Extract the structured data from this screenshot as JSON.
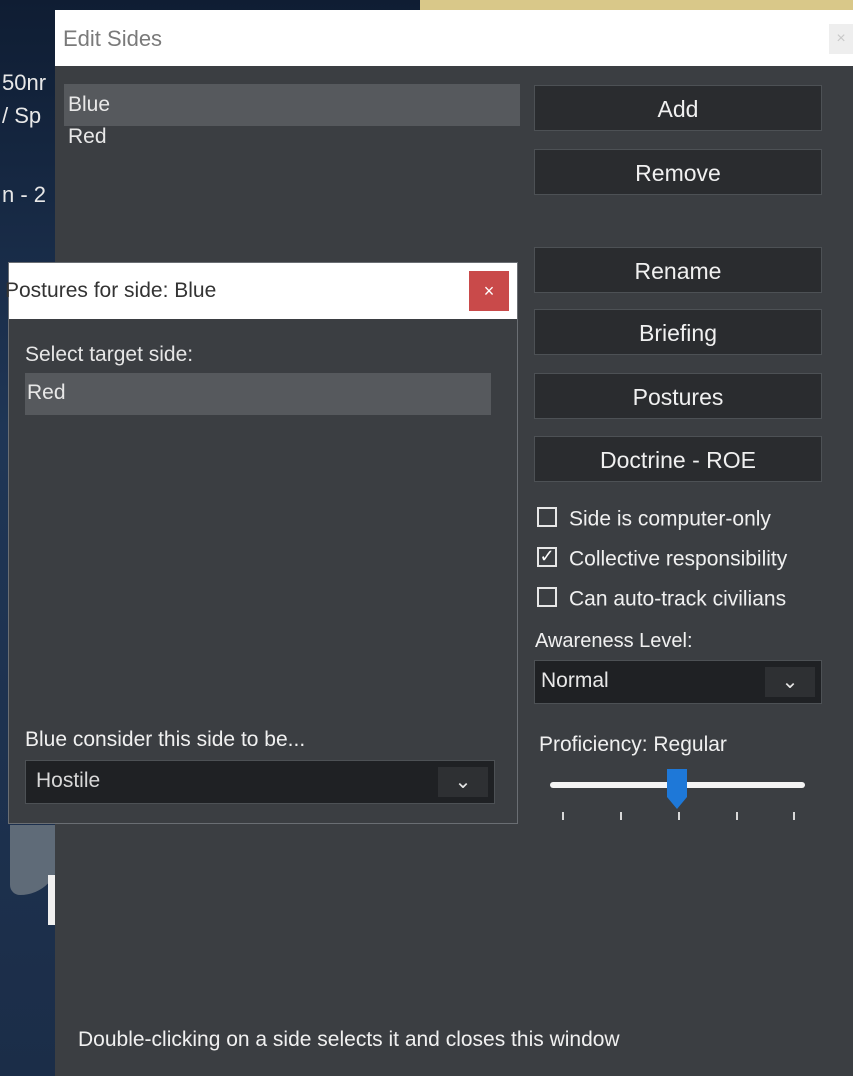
{
  "background": {
    "fragments": [
      "50nr",
      "/ Sp",
      "n - 2"
    ]
  },
  "edit_sides": {
    "title": "Edit Sides",
    "close_label": "×",
    "sides": [
      "Blue",
      "Red"
    ],
    "buttons": {
      "add": "Add",
      "remove": "Remove",
      "rename": "Rename",
      "briefing": "Briefing",
      "postures": "Postures",
      "doctrine": "Doctrine - ROE"
    },
    "checkboxes": [
      {
        "label": "Side is computer-only",
        "checked": false
      },
      {
        "label": "Collective responsibility",
        "checked": true
      },
      {
        "label": "Can auto-track civilians",
        "checked": false
      }
    ],
    "awareness": {
      "label": "Awareness Level:",
      "value": "Normal"
    },
    "proficiency": {
      "label": "Proficiency: Regular",
      "level_fraction": 0.5
    },
    "footer": "Double-clicking on a side selects it and closes this window"
  },
  "postures": {
    "title": "Postures for side: Blue",
    "close_label": "×",
    "target_label": "Select target side:",
    "targets": [
      "Red"
    ],
    "consider_label": "Blue consider this side to be...",
    "consider_value": "Hostile"
  },
  "colors": {
    "accent_blue": "#1e78d8",
    "close_red": "#c94a4a",
    "window_bg": "#3b3e42"
  },
  "icons": {
    "dropdown": "chevron-down-icon",
    "close": "close-icon",
    "check": "check-icon"
  }
}
